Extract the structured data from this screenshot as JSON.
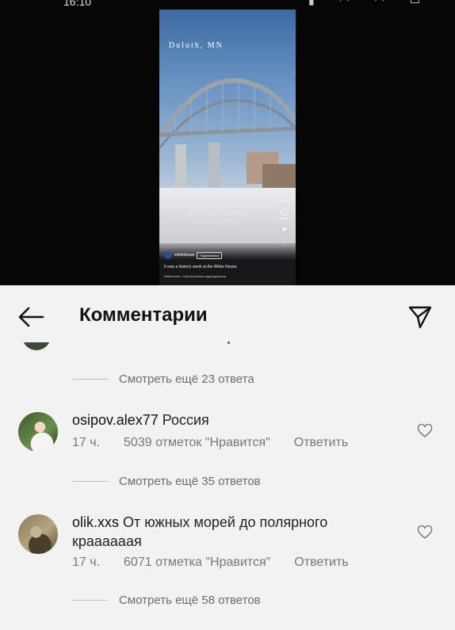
{
  "status_bar": {
    "time_fragment": "16:10",
    "icons": [
      "signal-icon",
      "wifi-icon",
      "battery-icon"
    ]
  },
  "video": {
    "city": "Duluth, MN",
    "tour_title": "Building a Better America Tour",
    "likes": "3,5 тыс.",
    "comments_count": "106 тыс.",
    "username": "whitehouse",
    "follow_label": "Подписаться",
    "caption": "It was a historic week at the White House.",
    "audio": "whitehouse • Оригинальная аудиодорожка"
  },
  "header": {
    "title": "Комментарии"
  },
  "threads": [
    {
      "view_more": "Смотреть ещё 23 ответа"
    },
    {
      "username": "osipov.alex77",
      "text": "Россия",
      "time": "17 ч.",
      "likes": "5039 отметок \"Нравится\"",
      "reply": "Ответить",
      "view_more": "Смотреть ещё 35 ответов"
    },
    {
      "username": "olik.xxs",
      "text": "От южных морей до полярного краааааая",
      "time": "17 ч.",
      "likes": "6071 отметка \"Нравится\"",
      "reply": "Ответить",
      "view_more": "Смотреть ещё 58 ответов"
    }
  ],
  "colors": {
    "sheet_bg": "#f2f2f2",
    "meta_text": "#777777",
    "title_text": "#111111"
  }
}
